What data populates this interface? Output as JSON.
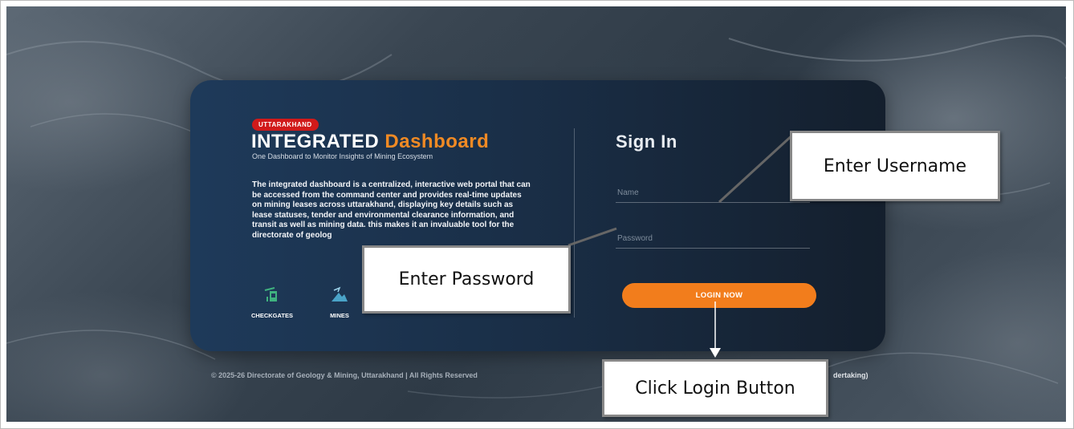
{
  "badge": "UTTARAKHAND",
  "brand": {
    "part1": "INTEGRATED",
    "part2": "Dashboard"
  },
  "tagline": "One Dashboard to Monitor Insights of Mining Ecosystem",
  "description": "The integrated dashboard is a centralized, interactive web portal that can be accessed from the command center and provides real-time updates on mining leases across uttarakhand, displaying key details such as lease statuses, tender and environmental clearance information, and transit as well as mining data. this makes it an invaluable tool for the directorate of geolog",
  "features": [
    {
      "label": "CHECKGATES",
      "icon": "checkgate-icon"
    },
    {
      "label": "MINES",
      "icon": "mines-icon"
    }
  ],
  "signin": {
    "title": "Sign In",
    "name_placeholder": "Name",
    "password_placeholder": "Password",
    "login_label": "LOGIN NOW"
  },
  "footer": {
    "copyright": "© 2025-26 Directorate of Geology & Mining, Uttarakhand | All Rights Reserved",
    "right": "dertaking)"
  },
  "annotations": {
    "username": "Enter Username",
    "password": "Enter Password",
    "login": "Click Login Button"
  },
  "colors": {
    "accent": "#f27d1c",
    "badge": "#d11a1a",
    "card": "#1a2f48"
  }
}
